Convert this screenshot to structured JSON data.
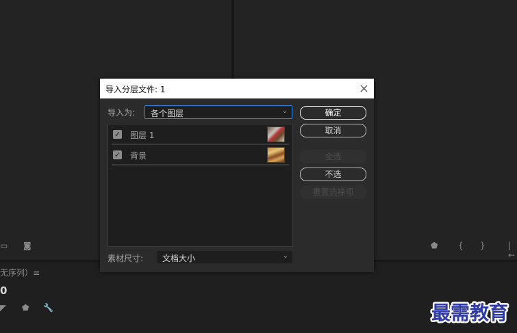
{
  "dialog": {
    "title": "导入分层文件: 1",
    "import_as_label": "导入为:",
    "import_as_value": "各个图层",
    "layers": [
      {
        "name": "图层 1",
        "checked": true
      },
      {
        "name": "背景",
        "checked": true
      }
    ],
    "footage_size_label": "素材尺寸:",
    "footage_size_value": "文档大小",
    "buttons": {
      "ok": "确定",
      "cancel": "取消",
      "select_all": "全选",
      "select_none": "不选",
      "reset": "重置选择项"
    }
  },
  "background": {
    "sequence_label": "无序列）",
    "timecode": "0"
  },
  "watermark": "最需教育",
  "colors": {
    "accent": "#2d8ceb",
    "watermark": "#2e3aa6"
  }
}
